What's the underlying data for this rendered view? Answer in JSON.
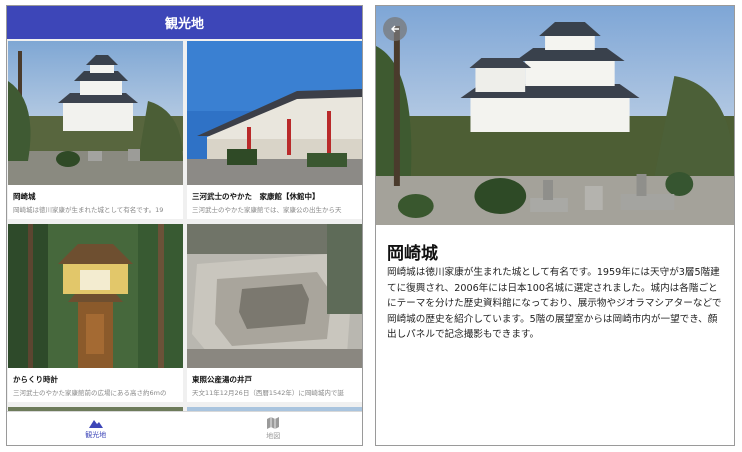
{
  "left": {
    "header": {
      "title": "観光地"
    },
    "cards": [
      {
        "title": "岡崎城",
        "desc": "岡崎城は徳川家康が生まれた城として有名です。19"
      },
      {
        "title": "三河武士のやかた　家康館【休館中】",
        "desc": "三河武士のやかた家康館では、家康公の出生から天"
      },
      {
        "title": "からくり時計",
        "desc": "三河武士のやかた家康館前の広場にある高さ約6mの"
      },
      {
        "title": "東照公産湯の井戸",
        "desc": "天文11年12月26日（西暦1542年）に岡崎城内で誕"
      }
    ],
    "nav": [
      {
        "label": "観光地",
        "icon": "mountain-icon",
        "active": true
      },
      {
        "label": "地図",
        "icon": "map-icon",
        "active": false
      }
    ]
  },
  "right": {
    "title": "岡崎城",
    "body": "岡崎城は徳川家康が生まれた城として有名です。1959年には天守が3層5階建てに復興され、2006年には日本100名城に選定されました。城内は各階ごとにテーマを分けた歴史資料館になっており、展示物やジオラマシアターなどで岡崎城の歴史を紹介しています。5階の展望室からは岡崎市内が一望でき、顔出しパネルで記念撮影もできます。",
    "back_icon": "arrow-left-icon"
  },
  "colors": {
    "accent": "#3d46b8",
    "inactive": "#9a9a9a"
  }
}
